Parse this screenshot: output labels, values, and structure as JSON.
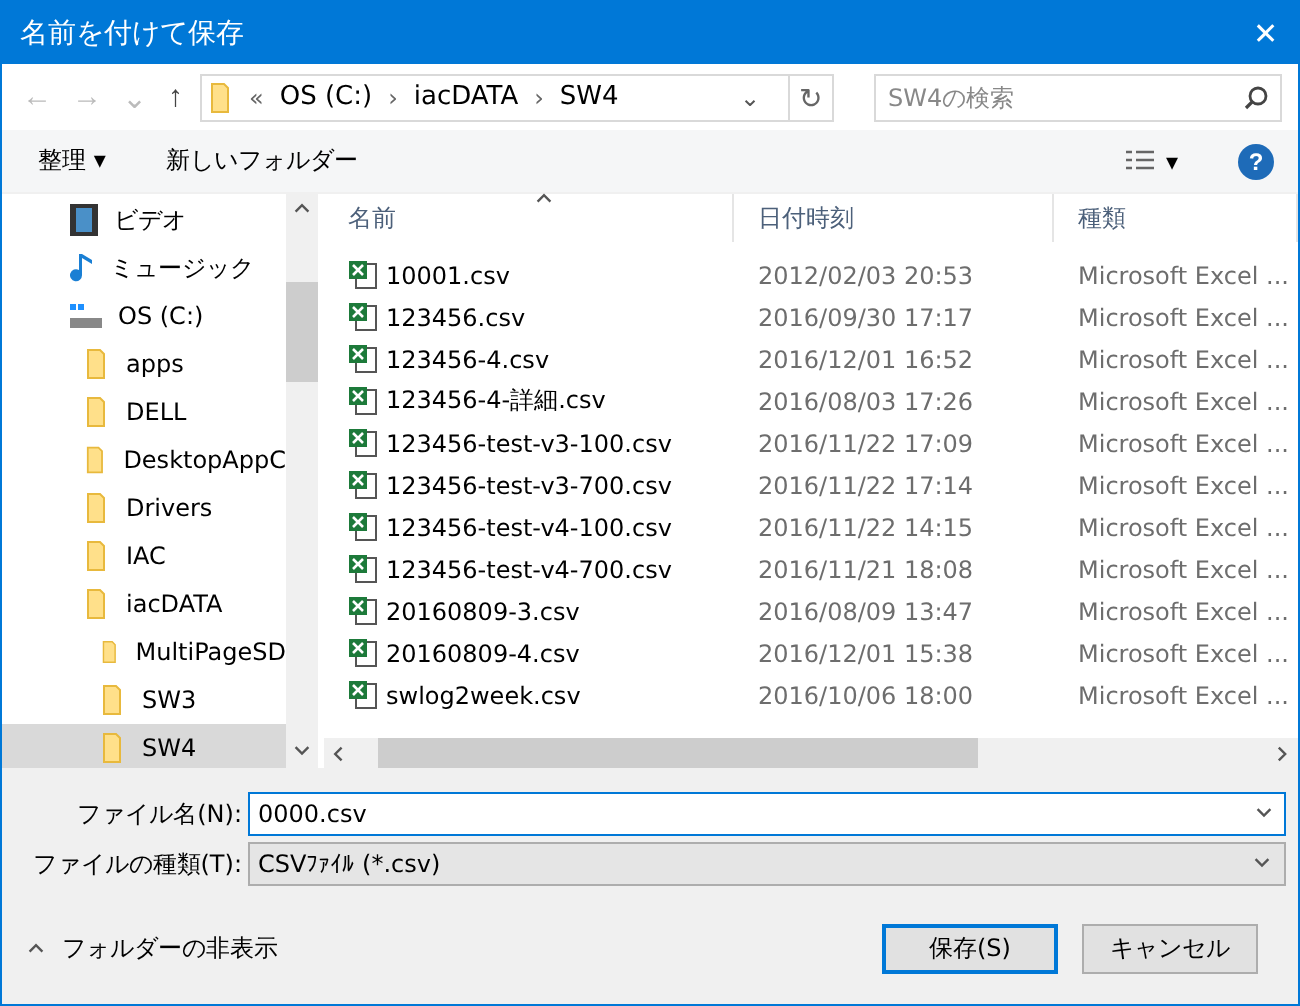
{
  "window": {
    "title": "名前を付けて保存",
    "close": "✕"
  },
  "nav": {
    "back": "←",
    "forward": "→",
    "recent": "⌄",
    "up": "↑",
    "path_prefix": "«",
    "path": [
      "OS (C:)",
      "iacDATA",
      "SW4"
    ],
    "separator": "›",
    "refresh": "↻",
    "search_placeholder": "SW4の検索"
  },
  "toolbar": {
    "organize": "整理 ▾",
    "new_folder": "新しいフォルダー",
    "view_caret": "▾",
    "help": "?"
  },
  "tree": [
    {
      "label": "ビデオ",
      "kind": "video",
      "selected": false
    },
    {
      "label": "ミュージック",
      "kind": "music",
      "selected": false
    },
    {
      "label": "OS (C:)",
      "kind": "drive",
      "selected": false,
      "children": [
        {
          "label": "apps",
          "kind": "folder",
          "selected": false
        },
        {
          "label": "DELL",
          "kind": "folder",
          "selected": false
        },
        {
          "label": "DesktopAppC",
          "kind": "folder",
          "selected": false
        },
        {
          "label": "Drivers",
          "kind": "folder",
          "selected": false
        },
        {
          "label": "IAC",
          "kind": "folder",
          "selected": false
        },
        {
          "label": "iacDATA",
          "kind": "folder",
          "selected": false,
          "children": [
            {
              "label": "MultiPageSD",
              "kind": "folder",
              "selected": false
            },
            {
              "label": "SW3",
              "kind": "folder",
              "selected": false
            },
            {
              "label": "SW4",
              "kind": "folder",
              "selected": true
            }
          ]
        }
      ]
    }
  ],
  "table": {
    "columns": [
      "名前",
      "日付時刻",
      "種類"
    ],
    "rows": [
      {
        "name": "10001.csv",
        "date": "2012/02/03 20:53",
        "type": "Microsoft Excel ..."
      },
      {
        "name": "123456.csv",
        "date": "2016/09/30 17:17",
        "type": "Microsoft Excel ..."
      },
      {
        "name": "123456-4.csv",
        "date": "2016/12/01 16:52",
        "type": "Microsoft Excel ..."
      },
      {
        "name": "123456-4-詳細.csv",
        "date": "2016/08/03 17:26",
        "type": "Microsoft Excel ..."
      },
      {
        "name": "123456-test-v3-100.csv",
        "date": "2016/11/22 17:09",
        "type": "Microsoft Excel ..."
      },
      {
        "name": "123456-test-v3-700.csv",
        "date": "2016/11/22 17:14",
        "type": "Microsoft Excel ..."
      },
      {
        "name": "123456-test-v4-100.csv",
        "date": "2016/11/22 14:15",
        "type": "Microsoft Excel ..."
      },
      {
        "name": "123456-test-v4-700.csv",
        "date": "2016/11/21 18:08",
        "type": "Microsoft Excel ..."
      },
      {
        "name": "20160809-3.csv",
        "date": "2016/08/09 13:47",
        "type": "Microsoft Excel ..."
      },
      {
        "name": "20160809-4.csv",
        "date": "2016/12/01 15:38",
        "type": "Microsoft Excel ..."
      },
      {
        "name": "swlog2week.csv",
        "date": "2016/10/06 18:00",
        "type": "Microsoft Excel ..."
      }
    ]
  },
  "form": {
    "filename_label": "ファイル名(N):",
    "filename_value": "0000.csv",
    "filetype_label": "ファイルの種類(T):",
    "filetype_value": "CSVﾌｧｲﾙ (*.csv)"
  },
  "footer": {
    "hide_folders": "フォルダーの非表示",
    "buttons": [
      {
        "label": "保存(S)",
        "default": true
      },
      {
        "label": "キャンセル",
        "default": false
      }
    ]
  }
}
